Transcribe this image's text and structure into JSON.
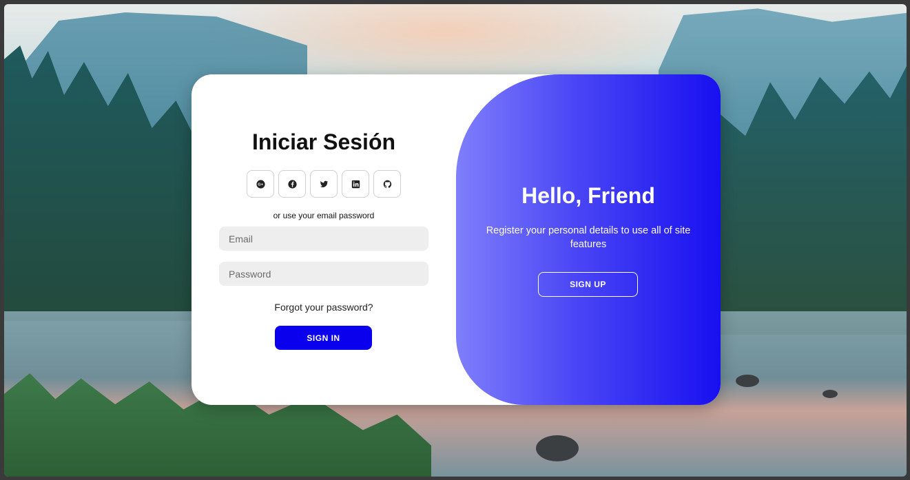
{
  "signin": {
    "title": "Iniciar Sesión",
    "social_buttons": [
      {
        "icon": "google-plus-icon"
      },
      {
        "icon": "facebook-icon"
      },
      {
        "icon": "twitter-icon"
      },
      {
        "icon": "linkedin-icon"
      },
      {
        "icon": "github-icon"
      }
    ],
    "divider_text": "or use your email password",
    "email_placeholder": "Email",
    "password_placeholder": "Password",
    "forgot_link": "Forgot your password?",
    "signin_button": "SIGN IN"
  },
  "toggle": {
    "title": "Hello, Friend",
    "text": "Register your personal details to use all of site features",
    "signup_button": "SIGN UP"
  },
  "colors": {
    "primary_button": "#0a00ee",
    "gradient_start": "#7f7ffb",
    "gradient_end": "#1810f0",
    "input_background": "#eeeeee"
  }
}
